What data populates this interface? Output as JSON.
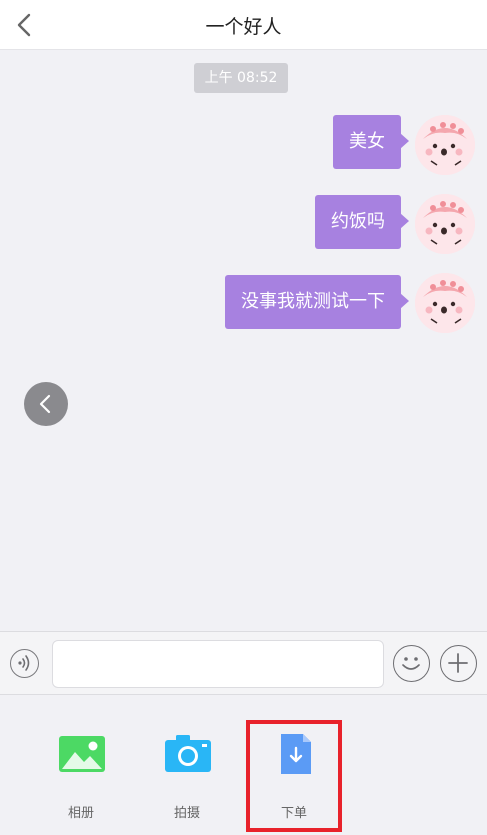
{
  "nav": {
    "title": "一个好人",
    "back_icon": "chevron-left-icon"
  },
  "chat": {
    "timestamp": "上午 08:52",
    "messages": [
      {
        "text": "美女",
        "sender": "me"
      },
      {
        "text": "约饭吗",
        "sender": "me"
      },
      {
        "text": "没事我就测试一下",
        "sender": "me"
      }
    ],
    "bubble_color": "#a781e0"
  },
  "input_bar": {
    "voice_icon": "voice-icon",
    "text_value": "",
    "emoji_icon": "emoji-icon",
    "plus_icon": "plus-icon"
  },
  "tools": [
    {
      "label": "相册",
      "icon": "image-icon",
      "color": "#4cd964"
    },
    {
      "label": "拍摄",
      "icon": "camera-icon",
      "color": "#29b6f6"
    },
    {
      "label": "下单",
      "icon": "order-file-icon",
      "color": "#5b9bf5"
    }
  ],
  "highlight_color": "#e8222b"
}
